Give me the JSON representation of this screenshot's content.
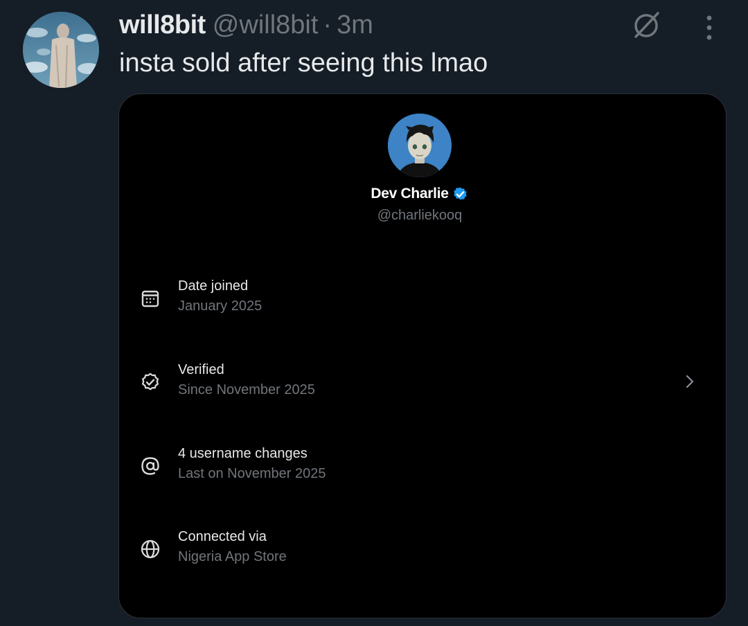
{
  "post": {
    "author_name": "will8bit",
    "author_handle": "@will8bit",
    "separator": "·",
    "time": "3m",
    "text": "insta sold after seeing this lmao"
  },
  "icons": {
    "grok": "grok-slash-circle-icon",
    "more": "more-vertical-icon"
  },
  "profile_card": {
    "name": "Dev Charlie",
    "handle": "@charliekooq",
    "verified_color": "#1d9bf0",
    "rows": [
      {
        "icon": "calendar-icon",
        "title": "Date joined",
        "subtitle": "January 2025"
      },
      {
        "icon": "verified-badge-icon",
        "title": "Verified",
        "subtitle": "Since November 2025",
        "has_chevron": true
      },
      {
        "icon": "at-sign-icon",
        "title": "4 username changes",
        "subtitle": "Last on November 2025"
      },
      {
        "icon": "globe-icon",
        "title": "Connected via",
        "subtitle": "Nigeria App Store"
      }
    ]
  },
  "colors": {
    "background": "#151d27",
    "card_background": "#000000",
    "primary_text": "#e7e9ea",
    "secondary_text": "#71767b"
  }
}
